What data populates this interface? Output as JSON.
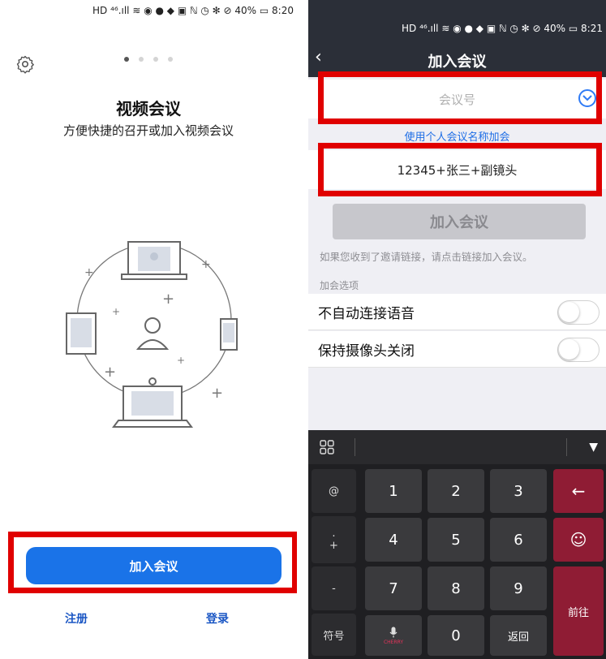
{
  "left": {
    "status_bar": "HD ⁴⁶.ıll ≋ ◉ ● ◆ ▣   ℕ ◷ ✻ ⊘ 40% ▭ 8:20",
    "title": "视频会议",
    "subtitle": "方便快捷的召开或加入视频会议",
    "join_button": "加入会议",
    "register_link": "注册",
    "login_link": "登录",
    "icons": [
      "gear-icon"
    ]
  },
  "right": {
    "status_bar": "HD ⁴⁶.ıll ≋ ◉ ● ◆ ▣   ℕ ◷ ✻ ⊘ 40% ▭ 8:21",
    "back_icon": "‹",
    "title": "加入会议",
    "meeting_id_placeholder": "会议号",
    "personal_name_link": "使用个人会议名称加会",
    "name_value": "12345+张三+副镜头",
    "join_button": "加入会议",
    "hint": "如果您收到了邀请链接，请点击链接加入会议。",
    "options_header": "加会选项",
    "option_audio": "不自动连接语音",
    "option_camera": "保持摄像头关闭",
    "keyboard": {
      "left_keys": [
        "@",
        ".",
        "+",
        "-",
        "符号"
      ],
      "digits": [
        "1",
        "2",
        "3",
        "4",
        "5",
        "6",
        "7",
        "8",
        "9",
        "0"
      ],
      "return": "返回",
      "go": "前往",
      "backspace": "←",
      "emoji": "☺",
      "mic_brand": "CHERRY"
    }
  },
  "colors": {
    "primary_blue": "#1a73e8",
    "highlight_red": "#e00000",
    "header_dark": "#2b2f38",
    "key_red": "#8f1c34"
  }
}
